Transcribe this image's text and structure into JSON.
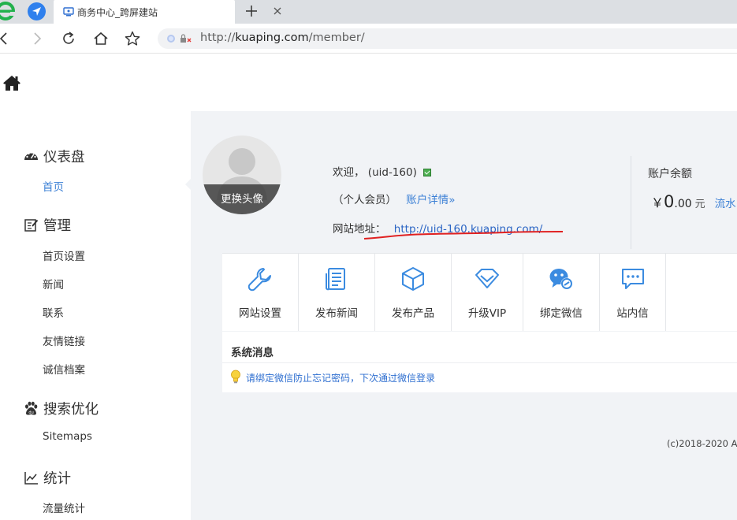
{
  "browser": {
    "tab_title": "商务中心_跨屏建站",
    "address_prefix": "http://",
    "address_domain": "kuaping.com",
    "address_path": "/member/"
  },
  "sidebar": {
    "sections": [
      {
        "title": "仪表盘",
        "icon": "dashboard-icon",
        "items": [
          "首页"
        ]
      },
      {
        "title": "管理",
        "icon": "edit-icon",
        "items": [
          "首页设置",
          "新闻",
          "联系",
          "友情链接",
          "诚信档案"
        ]
      },
      {
        "title": "搜索优化",
        "icon": "baidu-paw-icon",
        "items": [
          "Sitemaps"
        ]
      },
      {
        "title": "统计",
        "icon": "line-chart-icon",
        "items": [
          "流量统计"
        ]
      }
    ],
    "active_item": "首页"
  },
  "profile": {
    "avatar_label": "更换头像",
    "welcome_prefix": "欢迎，",
    "username": "(uid-160)",
    "member_type": "（个人会员）",
    "account_details_link": "账户详情»",
    "site_label": "网站地址：",
    "site_url": "http://uid-160.kuaping.com/"
  },
  "balance": {
    "label": "账户余额",
    "currency": "￥",
    "integer": "0",
    "decimals": ".00",
    "unit": "元",
    "flow_link": "流水"
  },
  "quick_actions": [
    {
      "label": "网站设置",
      "icon": "wrench-icon"
    },
    {
      "label": "发布新闻",
      "icon": "news-icon"
    },
    {
      "label": "发布产品",
      "icon": "cube-icon"
    },
    {
      "label": "升级VIP",
      "icon": "diamond-icon"
    },
    {
      "label": "绑定微信",
      "icon": "wechat-icon"
    },
    {
      "label": "站内信",
      "icon": "message-icon"
    }
  ],
  "system_messages": {
    "title": "系统消息",
    "messages": [
      "请绑定微信防止忘记密码，下次通过微信登录"
    ]
  },
  "footer": {
    "copyright": "(c)2018-2020 A"
  },
  "colors": {
    "accent": "#3a7fd5",
    "main_bg": "#f1f3f6",
    "icon_blue": "#3b8be0"
  }
}
